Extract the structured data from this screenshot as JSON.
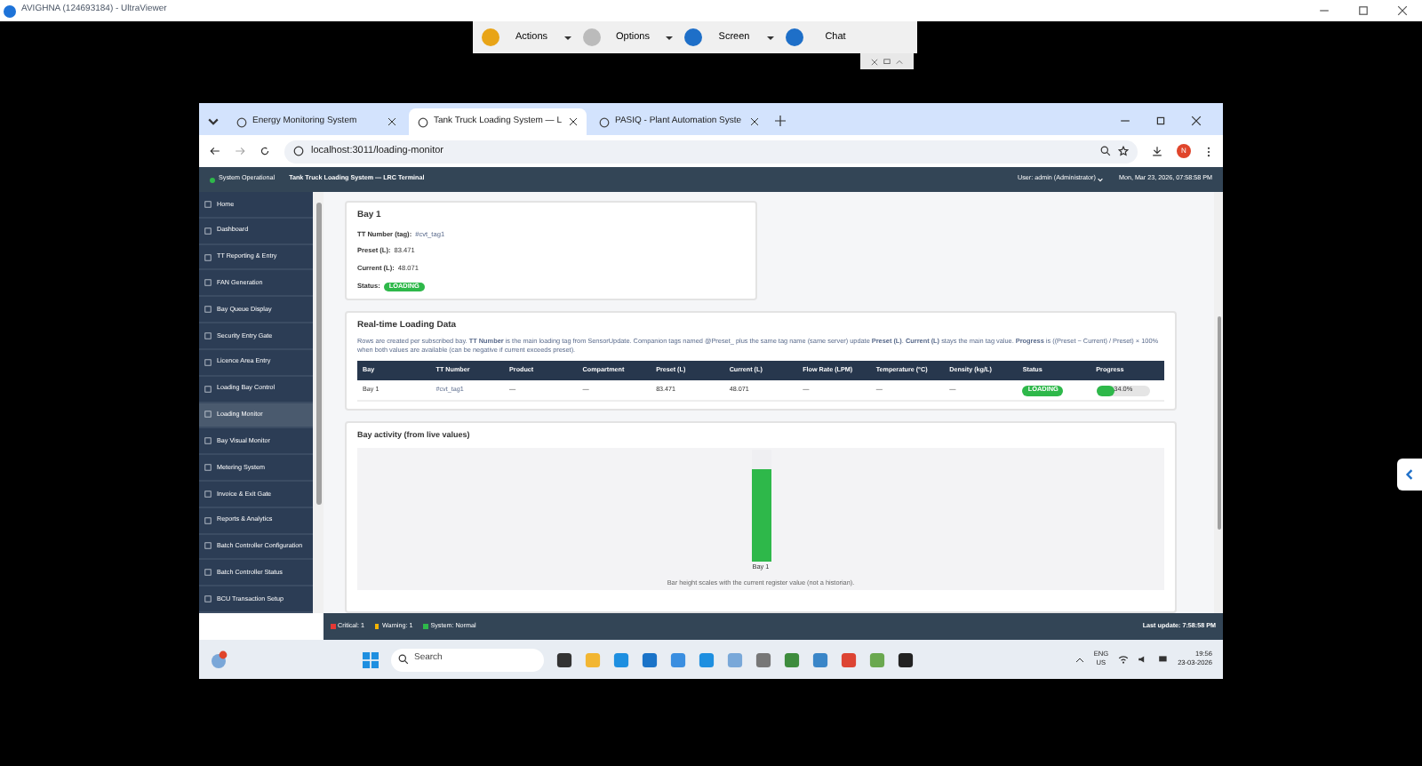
{
  "viewer": {
    "title": "AVIGHNA (124693184) - UltraViewer",
    "toolbar": [
      {
        "label": "Actions",
        "kind": "menu"
      },
      {
        "label": "Options",
        "kind": "menu"
      },
      {
        "label": "Screen",
        "kind": "menu"
      },
      {
        "label": "Chat",
        "kind": "plain"
      }
    ]
  },
  "browser": {
    "tabs": [
      {
        "title": "Energy Monitoring System",
        "selected": false
      },
      {
        "title": "Tank Truck Loading System — L",
        "selected": true
      },
      {
        "title": "PASIQ - Plant Automation Syste",
        "selected": false
      }
    ],
    "url": "localhost:3011/loading-monitor",
    "profile": "N"
  },
  "header": {
    "status": "System Operational",
    "title": "Tank Truck Loading System — LRC Terminal",
    "user": "User: admin (Administrator)",
    "datetime": "Mon, Mar 23, 2026, 07:58:58 PM"
  },
  "sidebar": {
    "items": [
      {
        "label": "Home",
        "selected": false
      },
      {
        "label": "Dashboard",
        "selected": false
      },
      {
        "label": "TT Reporting & Entry",
        "selected": false
      },
      {
        "label": "FAN Generation",
        "selected": false
      },
      {
        "label": "Bay Queue Display",
        "selected": false
      },
      {
        "label": "Security Entry Gate",
        "selected": false
      },
      {
        "label": "Licence Area Entry",
        "selected": false
      },
      {
        "label": "Loading Bay Control",
        "selected": false
      },
      {
        "label": "Loading Monitor",
        "selected": true
      },
      {
        "label": "Bay Visual Monitor",
        "selected": false
      },
      {
        "label": "Metering System",
        "selected": false
      },
      {
        "label": "Invoice & Exit Gate",
        "selected": false
      },
      {
        "label": "Reports & Analytics",
        "selected": false
      },
      {
        "label": "Batch Controller Configuration",
        "selected": false
      },
      {
        "label": "Batch Controller Status",
        "selected": false
      },
      {
        "label": "BCU Transaction Setup",
        "selected": false
      }
    ]
  },
  "bay_card": {
    "title": "Bay 1",
    "fields": [
      {
        "label": "TT Number (tag):",
        "value": "#cvt_tag1",
        "kind": "tag"
      },
      {
        "label": "Preset (L):",
        "value": "83.471",
        "kind": "text"
      },
      {
        "label": "Current (L):",
        "value": "48.071",
        "kind": "text"
      },
      {
        "label": "Status:",
        "value": "LOADING",
        "kind": "badge"
      }
    ]
  },
  "loading_data": {
    "title": "Real-time Loading Data",
    "note": "Rows are created per subscribed bay. **TT Number** is the main loading tag from SensorUpdate. Companion tags named @Preset_ plus the same tag name (same server) update **Preset (L)**. **Current (L)** stays the main tag value. **Progress** is ((Preset − Current) / Preset) × 100% when both values are available (can be negative if current exceeds preset).",
    "columns": [
      "Bay",
      "TT Number",
      "Product",
      "Compartment",
      "Preset (L)",
      "Current (L)",
      "Flow Rate (LPM)",
      "Temperature (°C)",
      "Density (kg/L)",
      "Status",
      "Progress"
    ],
    "rows": [
      {
        "cells": [
          "Bay 1",
          "#cvt_tag1",
          "—",
          "—",
          "83.471",
          "48.071",
          "—",
          "—",
          "—"
        ],
        "status": "LOADING",
        "progress": "34.0%",
        "level": 0.34
      }
    ]
  },
  "activity": {
    "title": "Bay activity (from live values)",
    "bars": [
      {
        "label": "Bay 1",
        "level": 0.82
      }
    ],
    "note": "Bar height scales with the current register value (not a historian)."
  },
  "footer": {
    "alerts": [
      {
        "label": "Critical: 1",
        "color": "#e53935"
      },
      {
        "label": "Warning: 1",
        "color": "#f5b400"
      },
      {
        "label": "System: Normal",
        "color": "#2eb84a"
      }
    ],
    "last_update": "Last update: 7:58:58 PM"
  },
  "taskbar": {
    "search_placeholder": "Search",
    "language": "ENG",
    "region": "US",
    "time": "19:56",
    "date": "23-03-2026"
  }
}
